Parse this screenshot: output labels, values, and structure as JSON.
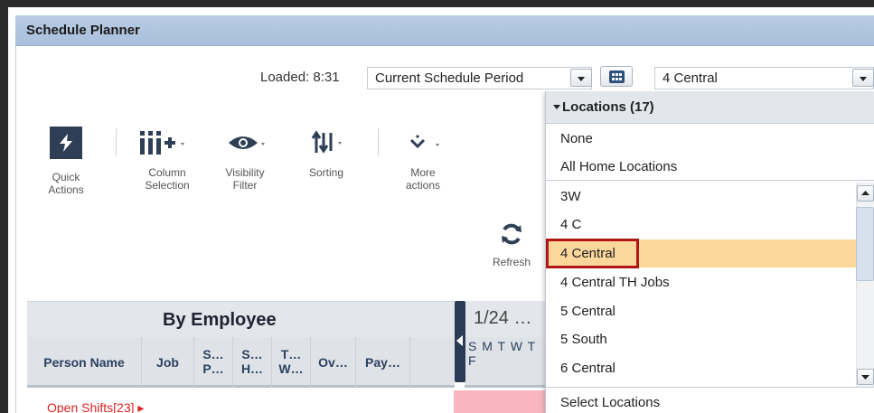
{
  "window": {
    "title": "Schedule Planner"
  },
  "toolbar_top": {
    "loaded_label": "Loaded: 8:31",
    "period_select_value": "Current Schedule Period",
    "location_select_value": "4 Central"
  },
  "actions": [
    {
      "icon": "lightning-icon",
      "label_line1": "Quick",
      "label_line2": "Actions"
    },
    {
      "icon": "column-selection-icon",
      "label_line1": "Column",
      "label_line2": "Selection"
    },
    {
      "icon": "eye-icon",
      "label_line1": "Visibility",
      "label_line2": "Filter"
    },
    {
      "icon": "sort-arrows-icon",
      "label_line1": "Sorting",
      "label_line2": ""
    },
    {
      "icon": "chevron-down-icon",
      "label_line1": "More",
      "label_line2": "actions"
    }
  ],
  "refresh": {
    "icon": "refresh-icon",
    "label": "Refresh"
  },
  "grid": {
    "group_title": "By Employee",
    "columns": [
      "Person Name",
      "Job",
      "S… P…",
      "S… H…",
      "T… W…",
      "Ov…",
      "Pay…"
    ],
    "columns_split": [
      [
        "Person Name"
      ],
      [
        "Job"
      ],
      [
        "S…",
        "P…"
      ],
      [
        "S…",
        "H…"
      ],
      [
        "T…",
        "W…"
      ],
      [
        "Ov…"
      ],
      [
        "Pay…"
      ]
    ],
    "date_header": "1/24 …",
    "days": "S M T W T F",
    "open_shifts": "Open Shifts[23] ▸"
  },
  "locations_dropdown": {
    "header": "Locations (17)",
    "fixed_items": [
      "None",
      "All Home Locations"
    ],
    "items": [
      "3W",
      "4 C",
      "4 Central",
      "4 Central TH Jobs",
      "5 Central",
      "5 South",
      "6 Central"
    ],
    "selected": "4 Central",
    "footer": "Select Locations"
  },
  "colors": {
    "title_bar": "#b7cbe3",
    "selected_item": "#fbd79b",
    "highlight_border": "#b01818",
    "open_shifts": "#dd2222"
  }
}
